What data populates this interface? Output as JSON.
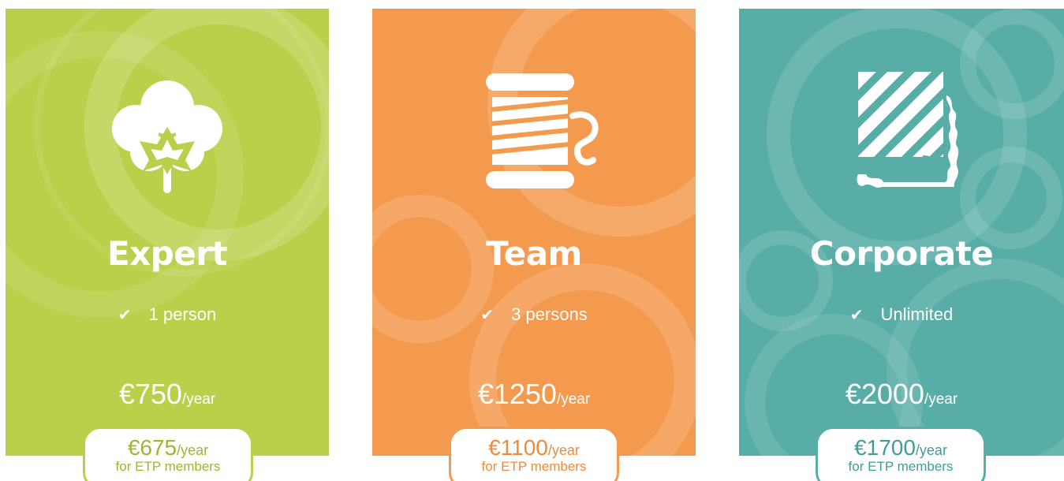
{
  "plans": [
    {
      "id": "expert",
      "name": "Expert",
      "icon": "cotton-icon",
      "color": "#b9d04a",
      "feature_check": "✔",
      "feature": "1 person",
      "price": "€750",
      "price_unit": "/year",
      "member_price": "€675",
      "member_unit": "/year",
      "member_note": "for ETP members"
    },
    {
      "id": "team",
      "name": "Team",
      "icon": "thread-spool-icon",
      "color": "#f49a4e",
      "feature_check": "✔",
      "feature": "3 persons",
      "price": "€1250",
      "price_unit": "/year",
      "member_price": "€1100",
      "member_unit": "/year",
      "member_note": "for ETP members"
    },
    {
      "id": "corporate",
      "name": "Corporate",
      "icon": "fabric-swatch-icon",
      "color": "#58ada7",
      "feature_check": "✔",
      "feature": "Unlimited",
      "price": "€2000",
      "price_unit": "/year",
      "member_price": "€1700",
      "member_unit": "/year",
      "member_note": "for ETP members"
    }
  ]
}
